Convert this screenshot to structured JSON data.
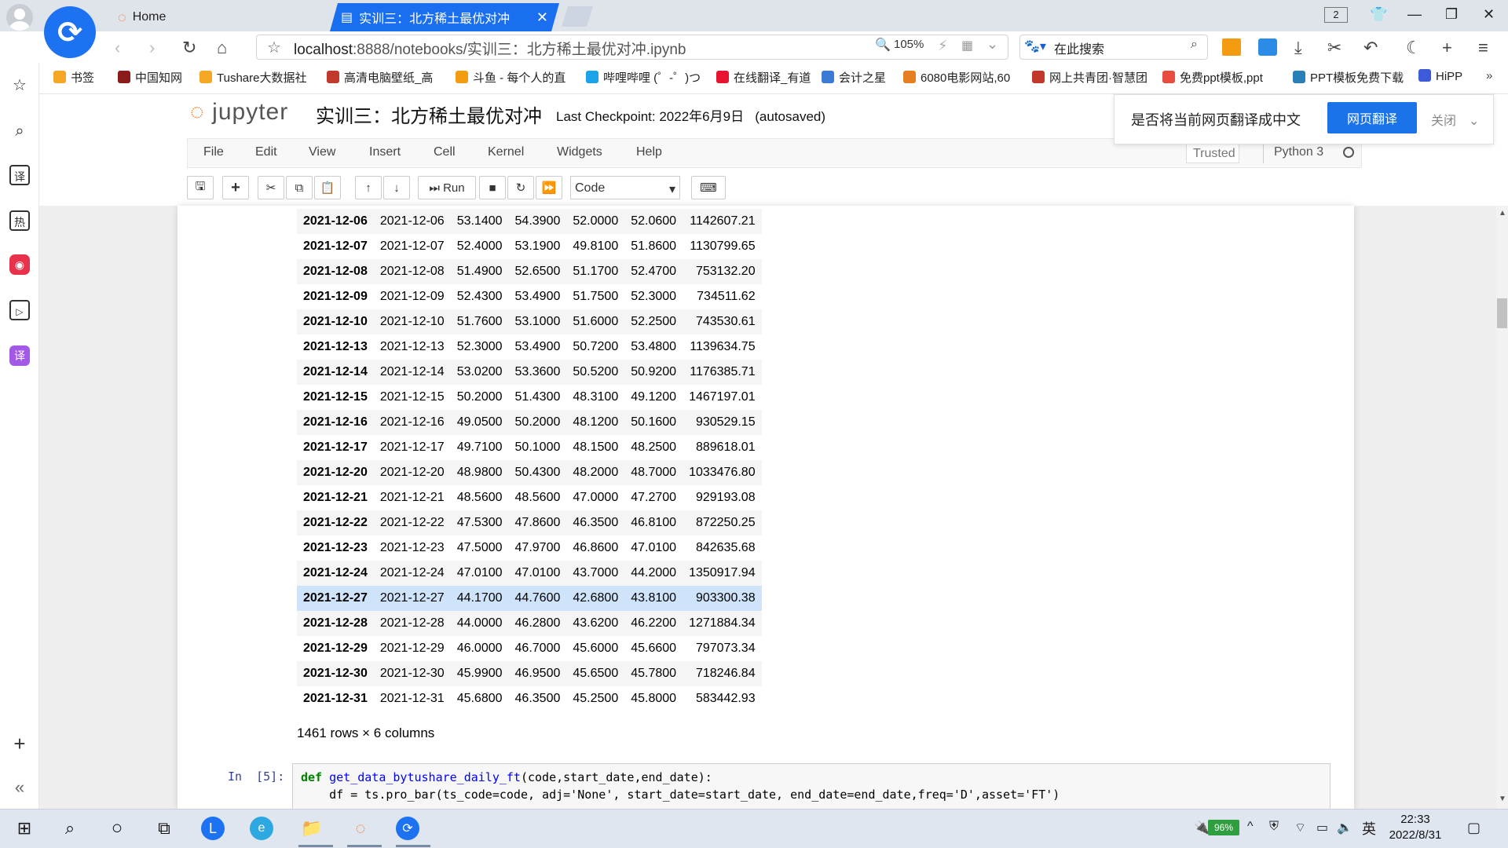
{
  "browser": {
    "tabs": [
      {
        "label": "Home"
      },
      {
        "label": "实训三：北方稀土最优对冲"
      }
    ],
    "tab_count": "2",
    "url_host": "localhost",
    "url_rest": ":8888/notebooks/实训三：北方稀土最优对冲.ipynb",
    "zoom": "105%",
    "search_placeholder": "在此搜索"
  },
  "bookmarks": [
    {
      "label": "书签",
      "color": "#f5a623"
    },
    {
      "label": "中国知网",
      "color": "#8b1a1a"
    },
    {
      "label": "Tushare大数据社",
      "color": "#f5a623"
    },
    {
      "label": "高清电脑壁纸_高",
      "color": "#c0392b"
    },
    {
      "label": "斗鱼 - 每个人的直",
      "color": "#f39c12"
    },
    {
      "label": "哔哩哔哩 (゜-゜)つ",
      "color": "#1aa3e8"
    },
    {
      "label": "在线翻译_有道",
      "color": "#e8142f"
    },
    {
      "label": "会计之星",
      "color": "#3a7bd5"
    },
    {
      "label": "6080电影网站,60",
      "color": "#e67e22"
    },
    {
      "label": "网上共青团·智慧团",
      "color": "#c0392b"
    },
    {
      "label": "免费ppt模板,ppt",
      "color": "#e74c3c"
    },
    {
      "label": "PPT模板免费下载",
      "color": "#2980b9"
    },
    {
      "label": "HiPP",
      "color": "#3b5bdb"
    }
  ],
  "jupyter": {
    "logo": "jupyter",
    "notebook_title": "实训三：北方稀土最优对冲",
    "checkpoint": "Last Checkpoint: 2022年6月9日   (autosaved)",
    "menus": [
      "File",
      "Edit",
      "View",
      "Insert",
      "Cell",
      "Kernel",
      "Widgets",
      "Help"
    ],
    "trusted": "Trusted",
    "kernel": "Python 3",
    "run_label": "Run",
    "cell_type": "Code"
  },
  "translate_popup": {
    "text": "是否将当前网页翻译成中文",
    "button": "网页翻译",
    "close": "关闭"
  },
  "dataframe": {
    "rows": [
      [
        "2021-12-06",
        "2021-12-06",
        "53.1400",
        "54.3900",
        "52.0000",
        "52.0600",
        "1142607.21"
      ],
      [
        "2021-12-07",
        "2021-12-07",
        "52.4000",
        "53.1900",
        "49.8100",
        "51.8600",
        "1130799.65"
      ],
      [
        "2021-12-08",
        "2021-12-08",
        "51.4900",
        "52.6500",
        "51.1700",
        "52.4700",
        "753132.20"
      ],
      [
        "2021-12-09",
        "2021-12-09",
        "52.4300",
        "53.4900",
        "51.7500",
        "52.3000",
        "734511.62"
      ],
      [
        "2021-12-10",
        "2021-12-10",
        "51.7600",
        "53.1000",
        "51.6000",
        "52.2500",
        "743530.61"
      ],
      [
        "2021-12-13",
        "2021-12-13",
        "52.3000",
        "53.4900",
        "50.7200",
        "53.4800",
        "1139634.75"
      ],
      [
        "2021-12-14",
        "2021-12-14",
        "53.0200",
        "53.3600",
        "50.5200",
        "50.9200",
        "1176385.71"
      ],
      [
        "2021-12-15",
        "2021-12-15",
        "50.2000",
        "51.4300",
        "48.3100",
        "49.1200",
        "1467197.01"
      ],
      [
        "2021-12-16",
        "2021-12-16",
        "49.0500",
        "50.2000",
        "48.1200",
        "50.1600",
        "930529.15"
      ],
      [
        "2021-12-17",
        "2021-12-17",
        "49.7100",
        "50.1000",
        "48.1500",
        "48.2500",
        "889618.01"
      ],
      [
        "2021-12-20",
        "2021-12-20",
        "48.9800",
        "50.4300",
        "48.2000",
        "48.7000",
        "1033476.80"
      ],
      [
        "2021-12-21",
        "2021-12-21",
        "48.5600",
        "48.5600",
        "47.0000",
        "47.2700",
        "929193.08"
      ],
      [
        "2021-12-22",
        "2021-12-22",
        "47.5300",
        "47.8600",
        "46.3500",
        "46.8100",
        "872250.25"
      ],
      [
        "2021-12-23",
        "2021-12-23",
        "47.5000",
        "47.9700",
        "46.8600",
        "47.0100",
        "842635.68"
      ],
      [
        "2021-12-24",
        "2021-12-24",
        "47.0100",
        "47.0100",
        "43.7000",
        "44.2000",
        "1350917.94"
      ],
      [
        "2021-12-27",
        "2021-12-27",
        "44.1700",
        "44.7600",
        "42.6800",
        "43.8100",
        "903300.38"
      ],
      [
        "2021-12-28",
        "2021-12-28",
        "44.0000",
        "46.2800",
        "43.6200",
        "46.2200",
        "1271884.34"
      ],
      [
        "2021-12-29",
        "2021-12-29",
        "46.0000",
        "46.7000",
        "45.6000",
        "45.6600",
        "797073.34"
      ],
      [
        "2021-12-30",
        "2021-12-30",
        "45.9900",
        "46.9500",
        "45.6500",
        "45.7800",
        "718246.84"
      ],
      [
        "2021-12-31",
        "2021-12-31",
        "45.6800",
        "46.3500",
        "45.2500",
        "45.8000",
        "583442.93"
      ]
    ],
    "highlighted_row": "2021-12-27",
    "shape": "1461 rows × 6 columns"
  },
  "code_cell": {
    "prompt": "In  [5]:",
    "line1_kw": "def",
    "line1_fn": "get_data_bytushare_daily_ft",
    "line1_rest": "(code,start_date,end_date):",
    "line2": "    df = ts.pro_bar(ts_code=code, adj='None', start_date=start_date, end_date=end_date,freq='D',asset='FT')"
  },
  "taskbar": {
    "battery": "96%",
    "ime": "英",
    "time": "22:33",
    "date": "2022/8/31"
  }
}
